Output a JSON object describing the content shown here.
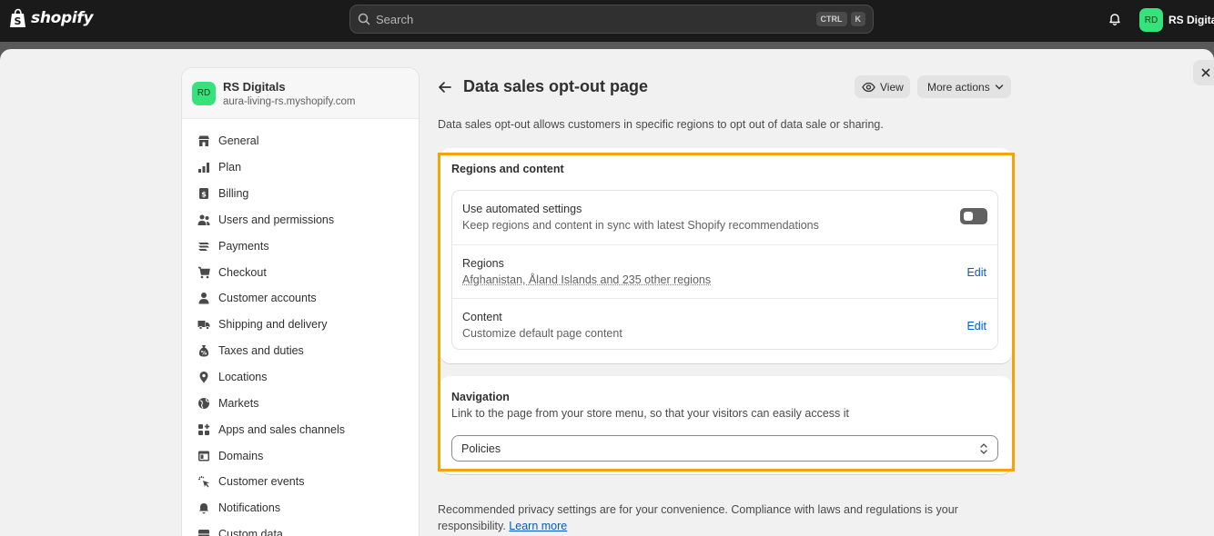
{
  "topbar": {
    "logo_text": "shopify",
    "search_placeholder": "Search",
    "shortcut_keys": [
      "CTRL",
      "K"
    ],
    "store_initials": "RD",
    "store_name": "RS Digitals"
  },
  "sidebar": {
    "store_initials": "RD",
    "store_name": "RS Digitals",
    "store_domain": "aura-living-rs.myshopify.com",
    "items": [
      {
        "label": "General",
        "icon": "store-icon"
      },
      {
        "label": "Plan",
        "icon": "chart-icon"
      },
      {
        "label": "Billing",
        "icon": "billing-icon"
      },
      {
        "label": "Users and permissions",
        "icon": "users-icon"
      },
      {
        "label": "Payments",
        "icon": "payments-icon"
      },
      {
        "label": "Checkout",
        "icon": "cart-icon"
      },
      {
        "label": "Customer accounts",
        "icon": "person-icon"
      },
      {
        "label": "Shipping and delivery",
        "icon": "truck-icon"
      },
      {
        "label": "Taxes and duties",
        "icon": "tax-icon"
      },
      {
        "label": "Locations",
        "icon": "pin-icon"
      },
      {
        "label": "Markets",
        "icon": "globe-icon"
      },
      {
        "label": "Apps and sales channels",
        "icon": "apps-icon"
      },
      {
        "label": "Domains",
        "icon": "domain-icon"
      },
      {
        "label": "Customer events",
        "icon": "cursor-icon"
      },
      {
        "label": "Notifications",
        "icon": "bell-icon"
      },
      {
        "label": "Custom data",
        "icon": "data-icon"
      }
    ]
  },
  "page": {
    "title": "Data sales opt-out page",
    "view_label": "View",
    "more_actions_label": "More actions",
    "description": "Data sales opt-out allows customers in specific regions to opt out of data sale or sharing."
  },
  "regions_card": {
    "title": "Regions and content",
    "automated": {
      "title": "Use automated settings",
      "subtitle": "Keep regions and content in sync with latest Shopify recommendations",
      "enabled": false
    },
    "regions": {
      "title": "Regions",
      "subtitle": "Afghanistan, Åland Islands and 235 other regions",
      "edit_label": "Edit"
    },
    "content": {
      "title": "Content",
      "subtitle": "Customize default page content",
      "edit_label": "Edit"
    }
  },
  "navigation_card": {
    "title": "Navigation",
    "subtitle": "Link to the page from your store menu, so that your visitors can easily access it",
    "selected_menu": "Policies"
  },
  "footer": {
    "note": "Recommended privacy settings are for your convenience. Compliance with laws and regulations is your responsibility.",
    "link": "Learn more"
  },
  "colors": {
    "highlight": "#f5a30b",
    "link": "#005bd3",
    "avatar": "#36e27c"
  }
}
